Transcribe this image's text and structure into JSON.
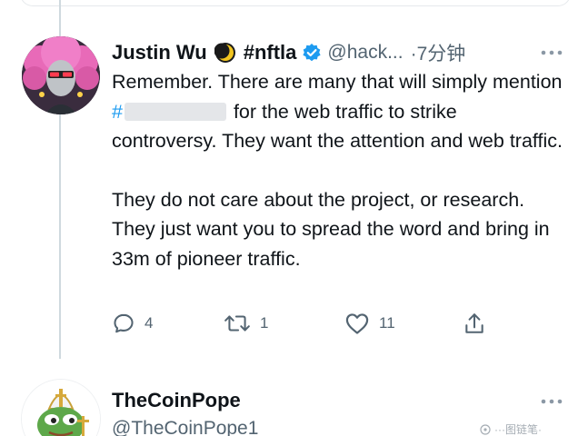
{
  "tweet": {
    "display_name": "Justin Wu",
    "hashtag_name": "#nftla",
    "handle": "@hack...",
    "time": "·7分钟",
    "body_line_1_prefix": "Remember. There are many that will simply mention ",
    "body_hashtag": "#",
    "body_line_1_suffix": " for the web traffic to strike controversy. They want the attention and web traffic.",
    "body_paragraph_2": "They do not care about the project, or research. They just want you to spread the word and bring in 33m of pioneer traffic.",
    "reply_count": "4",
    "retweet_count": "1",
    "like_count": "11"
  },
  "next_tweet": {
    "display_name": "TheCoinPope",
    "handle": "@TheCoinPope1"
  },
  "watermark": {
    "text": "···图链笔·"
  },
  "icons": {
    "avatar_1": "pink-hair-avatar",
    "avatar_2": "pope-frog-avatar",
    "moon": "crescent-moon-icon",
    "verified": "verified-badge-icon",
    "more": "more-icon",
    "reply": "reply-icon",
    "retweet": "retweet-icon",
    "like": "heart-icon",
    "share": "share-icon"
  },
  "colors": {
    "link": "#1d9bf0",
    "secondary_text": "#536471",
    "primary_text": "#0f1419",
    "verified": "#1d9bf0"
  }
}
